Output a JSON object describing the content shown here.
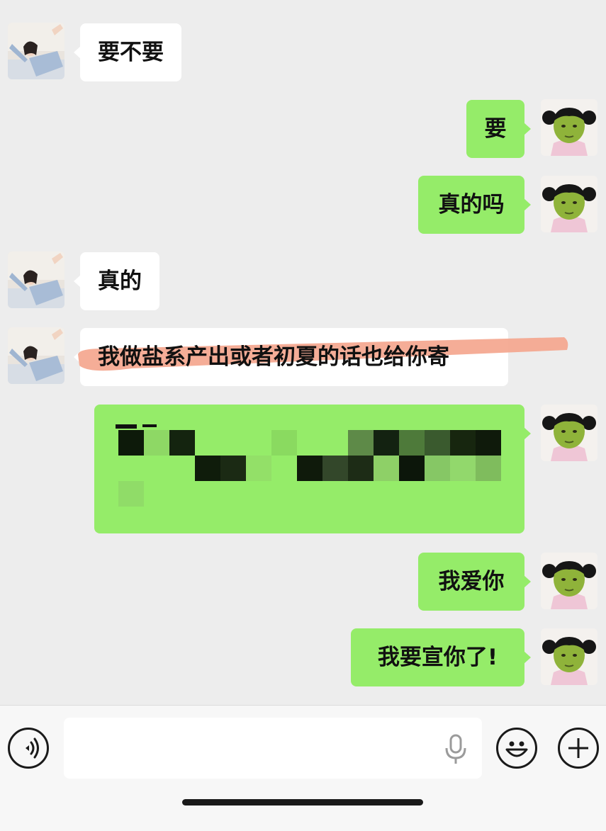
{
  "colors": {
    "background": "#ededed",
    "incoming_bubble": "#ffffff",
    "outgoing_bubble": "#95ec69",
    "highlight_stroke": "#f4a48c",
    "input_bar": "#f7f7f7"
  },
  "contact_avatar_icon": "girl-photo-avatar",
  "self_avatar_icon": "green-face-cartoon-avatar",
  "messages": [
    {
      "from": "them",
      "text": "要不要"
    },
    {
      "from": "me",
      "text": "要"
    },
    {
      "from": "me",
      "text": "真的吗"
    },
    {
      "from": "them",
      "text": "真的"
    },
    {
      "from": "them",
      "text": "我做盐系产出或者初夏的话也给你寄",
      "annotation": "highlighter stroke"
    },
    {
      "from": "me",
      "text": "",
      "note_redacted": true
    },
    {
      "from": "me",
      "text": "我爱你"
    },
    {
      "from": "me",
      "text": "我要宣你了!"
    }
  ],
  "input_bar": {
    "voice_icon": "voice-mode-icon",
    "text_value": "",
    "mic_icon": "microphone-icon",
    "emoji_icon": "emoji-icon",
    "plus_icon": "plus-icon"
  }
}
